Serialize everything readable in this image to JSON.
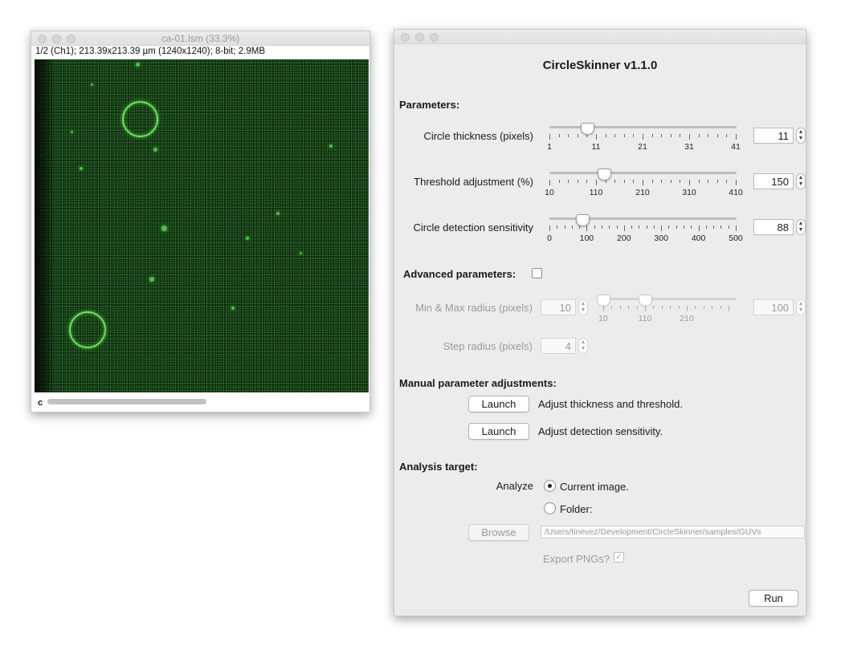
{
  "image_window": {
    "title": "ca-01.lsm (33.3%)",
    "info": "1/2 (Ch1); 213.39x213.39 µm (1240x1240); 8-bit; 2.9MB",
    "channel_label": "c"
  },
  "plugin": {
    "title": "CircleSkinner v1.1.0",
    "parameters_header": "Parameters:",
    "params": [
      {
        "label": "Circle thickness (pixels)",
        "value": "11",
        "slider_fraction": 0.2,
        "tick_labels": [
          "1",
          "11",
          "21",
          "31",
          "41"
        ]
      },
      {
        "label": "Threshold adjustment (%)",
        "value": "150",
        "slider_fraction": 0.29,
        "tick_labels": [
          "10",
          "110",
          "210",
          "310",
          "410"
        ]
      },
      {
        "label": "Circle detection sensitivity",
        "value": "88",
        "slider_fraction": 0.176,
        "tick_labels": [
          "0",
          "100",
          "200",
          "300",
          "400",
          "500"
        ]
      }
    ],
    "advanced": {
      "label": "Advanced parameters:",
      "checked": false,
      "minmax_label": "Min & Max radius (pixels)",
      "min_value": "10",
      "max_value": "100",
      "range_tick_labels": [
        "10",
        "110",
        "210"
      ],
      "step_label": "Step radius (pixels)",
      "step_value": "4"
    },
    "manual": {
      "header": "Manual parameter adjustments:",
      "launch_label": "Launch",
      "adjust1": "Adjust thickness and threshold.",
      "adjust2": "Adjust detection sensitivity."
    },
    "target": {
      "header": "Analysis target:",
      "analyze_label": "Analyze",
      "current_image": "Current image.",
      "folder": "Folder:",
      "selected": "current_image",
      "browse_label": "Browse",
      "path": "/Users/tinevez/Development/CircleSkinner/samples/GUVs",
      "export_label": "Export PNGs?",
      "export_checked": true
    },
    "run_label": "Run"
  }
}
